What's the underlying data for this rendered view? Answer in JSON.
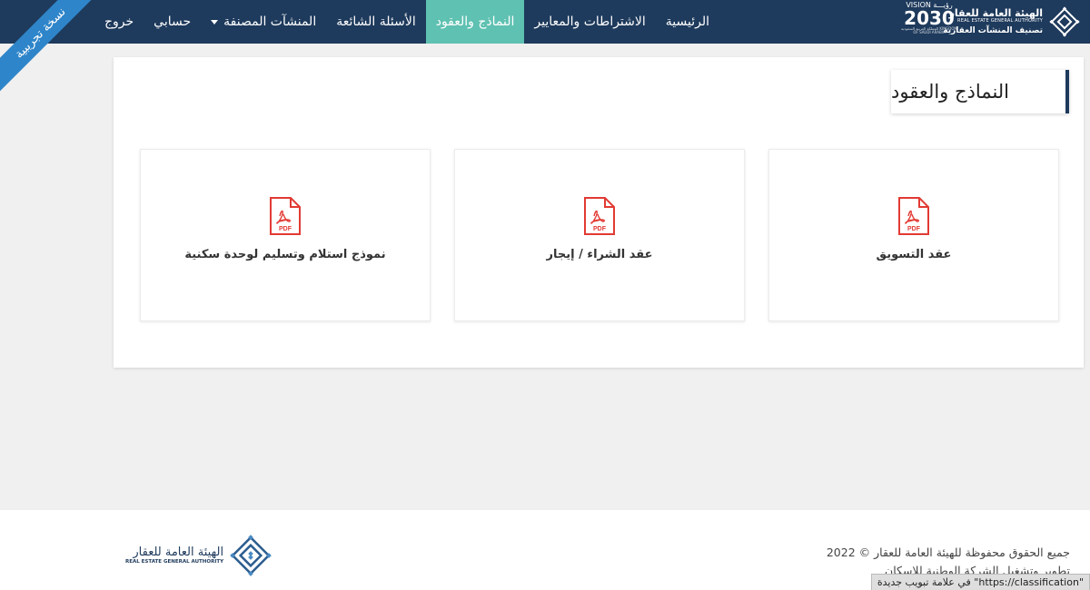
{
  "ribbon": {
    "text": "نسخة تجريبية"
  },
  "brand": {
    "name_ar": "الهيئة العامة للعقار",
    "name_en": "REAL ESTATE GENERAL AUTHORITY",
    "subtitle": "تصنيف المنشآت العقارية",
    "vision_small": "VISION رؤيـــة",
    "vision_year": "2030",
    "vision_foot": "المملكة العربية السعودية KINGDOM OF SAUDI ARABIA"
  },
  "nav": {
    "items": [
      {
        "label": "الرئيسية",
        "active": false
      },
      {
        "label": "الاشتراطات والمعايير",
        "active": false
      },
      {
        "label": "النماذج والعقود",
        "active": true
      },
      {
        "label": "الأسئلة الشائعة",
        "active": false
      },
      {
        "label": "المنشآت المصنفة",
        "active": false,
        "dropdown": true
      },
      {
        "label": "حسابي",
        "active": false
      },
      {
        "label": "خروج",
        "active": false
      }
    ]
  },
  "page": {
    "title": "النماذج والعقود"
  },
  "documents": [
    {
      "label": "عقد التسويق",
      "icon": "pdf-icon",
      "icon_text": "PDF"
    },
    {
      "label": "عقد الشراء / إيجار",
      "icon": "pdf-icon",
      "icon_text": "PDF"
    },
    {
      "label": "نموذج استلام وتسليم لوحدة سكنية",
      "icon": "pdf-icon",
      "icon_text": "PDF"
    }
  ],
  "footer": {
    "copyright": "جميع الحقوق محفوظة للهيئة العامة للعقار © 2022",
    "developer": "تطوير وتشغيل الشركة الوطنية للإسكان",
    "logo_ar": "الهيئة العامة للعقار",
    "logo_en": "REAL ESTATE GENERAL AUTHORITY"
  },
  "status_bar": {
    "text": "\"https://classification\" في علامة تبويب جديدة"
  },
  "colors": {
    "navbar": "#1e3a5c",
    "active_tab": "#5fc1b1",
    "ribbon": "#2f85c9",
    "pdf_red": "#e23a33",
    "background": "#f0f0f0"
  }
}
